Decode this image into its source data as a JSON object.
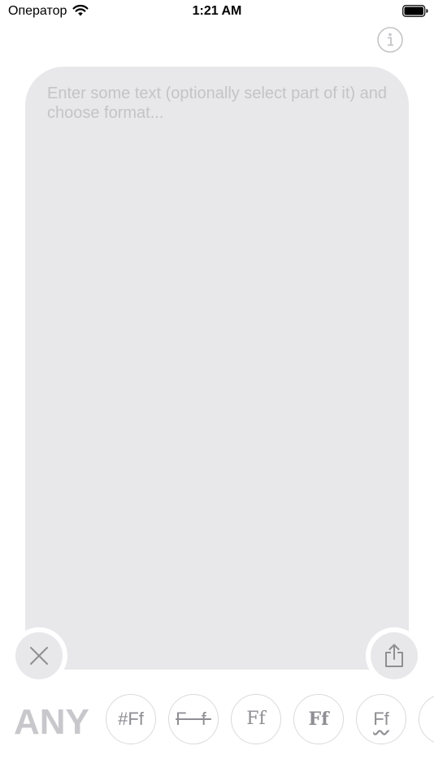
{
  "status_bar": {
    "carrier": "Оператор",
    "time": "1:21 AM"
  },
  "editor": {
    "placeholder": "Enter some text (optionally select part of it) and choose format..."
  },
  "format_bar": {
    "any_label": "ANY",
    "formats": [
      {
        "name": "hashtag",
        "label": "#Ff"
      },
      {
        "name": "strikethrough",
        "label": "F f"
      },
      {
        "name": "double-struck",
        "label": "Ff"
      },
      {
        "name": "flipped",
        "label": "Ff"
      },
      {
        "name": "wavy-underline",
        "label": "Ff"
      }
    ]
  },
  "colors": {
    "editor_bg": "#e8e8ea",
    "placeholder": "#c4c4c8",
    "icon_gray": "#8e8e93",
    "any_label": "#c8c8cc"
  },
  "icons": [
    "wifi-icon",
    "battery-icon",
    "info-icon",
    "close-icon",
    "share-icon"
  ]
}
